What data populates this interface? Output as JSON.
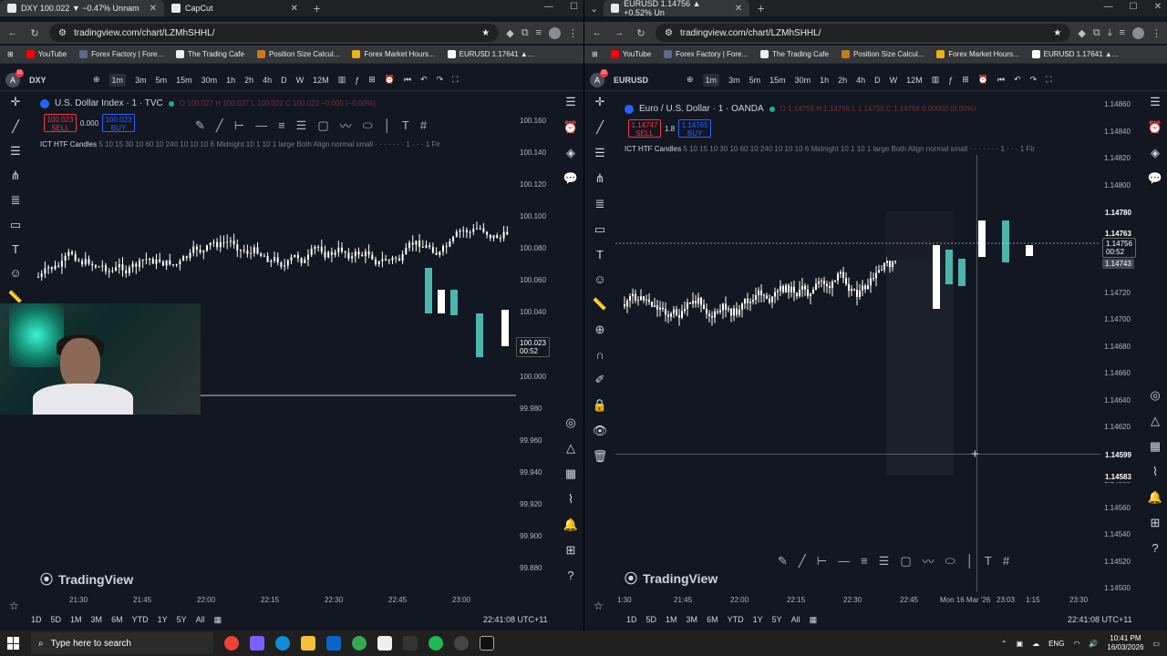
{
  "left_window": {
    "tabs": [
      {
        "label": "DXY 100.022 ▼ −0.47% Unnam",
        "active": true
      },
      {
        "label": "CapCut",
        "active": false
      }
    ],
    "url": "tradingview.com/chart/LZMhSHHL/",
    "bookmarks": [
      "YouTube",
      "Forex Factory | Fore...",
      "The Trading Cafe",
      "Position Size Calcul...",
      "Forex Market Hours...",
      "EURUSD 1.17641 ▲..."
    ],
    "toolbar": {
      "symbol": "DXY",
      "timeframes": [
        "1m",
        "3m",
        "5m",
        "15m",
        "30m",
        "1h",
        "2h",
        "4h",
        "D",
        "W",
        "12M"
      ],
      "selected_tf": "1m"
    },
    "legend": {
      "title": "U.S. Dollar Index · 1 · TVC",
      "ohlc": "O 100.027  H 100.027  L 100.022  C 100.022  −0.005 (−0.00%)"
    },
    "sell": {
      "price": "100.023",
      "label": "SELL"
    },
    "spread": "0.000",
    "buy": {
      "price": "100.023",
      "label": "BUY"
    },
    "indicator": {
      "name": "ICT HTF Candles",
      "params": "5 10 15 30 10 60 10 240 10 10 10 6 Midnight 10 1 10 1 large Both Align normal small · · · · · · · 1 · · · 1 Fir"
    },
    "price_ticks": [
      "100.160",
      "100.140",
      "100.120",
      "100.100",
      "100.080",
      "100.060",
      "100.040",
      "100.000",
      "99.980",
      "99.960",
      "99.940",
      "99.920",
      "99.900",
      "99.880"
    ],
    "current_price": {
      "value": "100.023",
      "countdown": "00:52"
    },
    "time_ticks": [
      "21:30",
      "21:45",
      "22:00",
      "22:15",
      "22:30",
      "22:45",
      "23:00"
    ],
    "ranges": [
      "1D",
      "5D",
      "1M",
      "3M",
      "6M",
      "YTD",
      "1Y",
      "5Y",
      "All"
    ],
    "utc": "22:41:08 UTC+11",
    "watermark": "TradingView"
  },
  "right_window": {
    "tabs": [
      {
        "label": "EURUSD 1.14756 ▲ +0.52% Un",
        "active": true
      }
    ],
    "url": "tradingview.com/chart/LZMhSHHL/",
    "bookmarks": [
      "YouTube",
      "Forex Factory | Fore...",
      "The Trading Cafe",
      "Position Size Calcul...",
      "Forex Market Hours...",
      "EURUSD 1.17641 ▲..."
    ],
    "toolbar": {
      "symbol": "EURUSD",
      "timeframes": [
        "1m",
        "3m",
        "5m",
        "15m",
        "30m",
        "1h",
        "2h",
        "4h",
        "D",
        "W",
        "12M"
      ],
      "selected_tf": "1m"
    },
    "legend": {
      "title": "Euro / U.S. Dollar · 1 · OANDA",
      "ohlc": "O 1.14756  H 1.14756  L 1.14755  C 1.14756  0.00000 (0.00%)"
    },
    "sell": {
      "price": "1.14747",
      "label": "SELL"
    },
    "spread": "1.8",
    "buy": {
      "price": "1.14765",
      "label": "BUY"
    },
    "indicator": {
      "name": "ICT HTF Candles",
      "params": "5 10 15 10 30 10 60 10 240 10 10 10 6 Midnight 10 1 10 1 large Both Align normal small · · · · · · · 1 · · · 1 Fir"
    },
    "price_ticks": [
      "1.14860",
      "1.14840",
      "1.14820",
      "1.14800",
      "1.14780",
      "1.14760",
      "1.14740",
      "1.14720",
      "1.14700",
      "1.14680",
      "1.14660",
      "1.14640",
      "1.14620",
      "1.14600",
      "1.14580",
      "1.14560",
      "1.14540",
      "1.14520",
      "1.14500"
    ],
    "price_labels": {
      "high": "1.14780",
      "current": "1.14763",
      "mid": "1.14756",
      "countdown": "00:52",
      "low": "1.14743",
      "cross": "1.14599",
      "bottom": "1.14583"
    },
    "time_ticks": [
      "1:30",
      "21:45",
      "22:00",
      "22:15",
      "22:30",
      "22:45",
      "Mon 16 Mar '26",
      "23:03",
      "1:15",
      "23:30"
    ],
    "ranges": [
      "1D",
      "5D",
      "1M",
      "3M",
      "6M",
      "YTD",
      "1Y",
      "5Y",
      "All"
    ],
    "utc": "22:41:08 UTC+11",
    "watermark": "TradingView"
  },
  "taskbar": {
    "search_placeholder": "Type here to search",
    "lang": "ENG",
    "time": "10:41 PM",
    "date": "16/03/2026"
  },
  "colors": {
    "up": "#4db6ac",
    "down": "#f7525f",
    "bg": "#131722",
    "sell": "#f23645",
    "buy": "#2962ff"
  }
}
